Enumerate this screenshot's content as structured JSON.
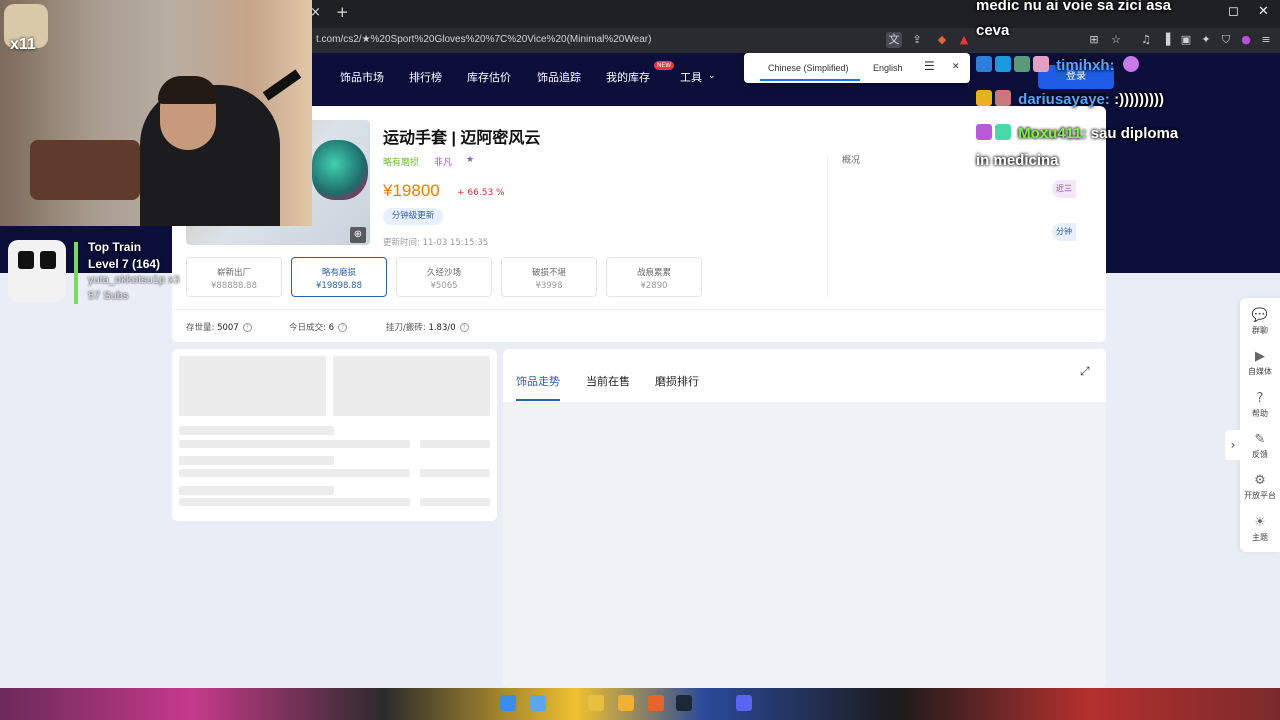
{
  "browser": {
    "url": "t.com/cs2/★%20Sport%20Gloves%20%7C%20Vice%20(Minimal%20Wear)",
    "tab_close": "×",
    "tab_new": "+",
    "win_close": "✕",
    "win_restore": "◻"
  },
  "site_nav": {
    "items": [
      "饰品市场",
      "排行榜",
      "库存估价",
      "饰品追踪",
      "我的库存",
      "工具"
    ],
    "new_badge": "NEW",
    "tools_arrow": "⌄",
    "login": "登录"
  },
  "translate_popup": {
    "lang1": "Chinese (Simplified)",
    "lang2": "English",
    "menu_icon": "☰",
    "close_icon": "✕"
  },
  "product": {
    "title": "运动手套 | 迈阿密风云",
    "tags": [
      "略有磨损",
      "非凡",
      "★"
    ],
    "tag_colors": [
      "#6bbf3a",
      "#b04ab8",
      "#8a5cc7"
    ],
    "price": "¥19800",
    "change": "+ 66.53 %",
    "update_pill": "分钟级更新",
    "update_time": "更新时间:  11-03 15:15:35",
    "overview": "概况",
    "right_chips": [
      "近三",
      "分钟"
    ]
  },
  "wear_options": [
    {
      "name": "崭新出厂",
      "price": "¥88888.88",
      "selected": false
    },
    {
      "name": "略有磨损",
      "price": "¥19898.88",
      "selected": true
    },
    {
      "name": "久经沙场",
      "price": "¥5065",
      "selected": false
    },
    {
      "name": "破损不堪",
      "price": "¥3998",
      "selected": false
    },
    {
      "name": "战痕累累",
      "price": "¥2890",
      "selected": false
    }
  ],
  "stats": [
    {
      "label": "存世量:",
      "value": "5007"
    },
    {
      "label": "今日成交:",
      "value": "6"
    },
    {
      "label": "挂刀/搬砖:",
      "value": "1.83/0"
    }
  ],
  "tabs": [
    "饰品走势",
    "当前在售",
    "磨损排行"
  ],
  "side_bar": [
    {
      "icon": "💬",
      "label": "群聊"
    },
    {
      "icon": "▶",
      "label": "自媒体"
    },
    {
      "icon": "?",
      "label": "帮助"
    },
    {
      "icon": "✎",
      "label": "反馈"
    },
    {
      "icon": "⚙",
      "label": "开放平台"
    },
    {
      "icon": "☀",
      "label": "主题"
    }
  ],
  "collapse_arrow": "›",
  "overlay": {
    "x11": "x11",
    "train_title": "Top Train",
    "train_level": "Level 7 (164)",
    "train_user": "yuta_okkotsu1p x3",
    "train_subs": "57 Subs",
    "chat": [
      {
        "user": "",
        "text": "medic nu ai voie sa zici asa"
      },
      {
        "user": "",
        "text": "ceva"
      },
      {
        "user": "timihxh:",
        "text": ""
      },
      {
        "user": "dariusayaye:",
        "text": ":)))))))))"
      },
      {
        "user": "Moxu411:",
        "text": "sau diploma"
      },
      {
        "user": "",
        "text": "in medicina"
      }
    ]
  }
}
